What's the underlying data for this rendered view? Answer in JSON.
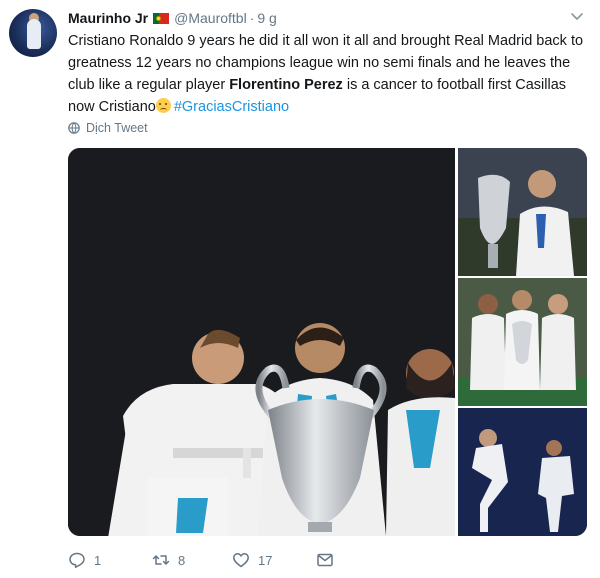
{
  "tweet": {
    "author": {
      "name": "Maurinho Jr",
      "handle": "@Mauroftbl",
      "separator": "·",
      "time": "9 g"
    },
    "text": {
      "part1": "Cristiano Ronaldo 9 years he did it all won it all and brought Real Madrid back to greatness 12 years no champions league win no semi finals and he leaves the club like a regular player ",
      "bold": "Florentino Perez",
      "part2": " is a cancer to football first Casillas now Cristiano",
      "hashtag": "#GraciasCristiano"
    },
    "translate_label": "Dịch Tweet",
    "actions": {
      "replies": "1",
      "retweets": "8",
      "likes": "17"
    }
  },
  "colors": {
    "link": "#1b95e0",
    "muted": "#657786",
    "text": "#14171a"
  },
  "icons": [
    "chevron-down-icon",
    "globe-icon",
    "reply-icon",
    "retweet-icon",
    "heart-icon",
    "mail-icon",
    "portugal-flag-icon",
    "sad-face-emoji"
  ]
}
